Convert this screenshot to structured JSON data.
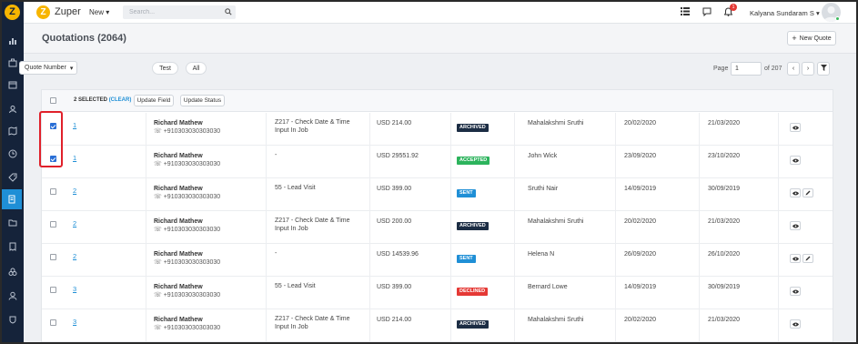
{
  "app": {
    "name": "Zuper",
    "new_menu": "New",
    "search_placeholder": "Search...",
    "user_name": "Kalyana Sundaram S",
    "notification_count": "1"
  },
  "page": {
    "title": "Quotations (2064)",
    "new_quote": "New Quote"
  },
  "filters": {
    "dropdown": "Quote Number",
    "pills": [
      "Test",
      "All"
    ]
  },
  "pagination": {
    "label": "Page",
    "current": "1",
    "total": "of 207"
  },
  "selection": {
    "count_text": "2 SELECTED",
    "clear_text": "(CLEAR)",
    "update_field": "Update Field",
    "update_status": "Update Status"
  },
  "colors": {
    "archived": "#1c2d44",
    "accepted": "#2cb35c",
    "sent": "#1f8fd6",
    "declined": "#e53935"
  },
  "rows": [
    {
      "checked": true,
      "number": "1",
      "customer": "Richard Mathew",
      "phone": "+910303030303030",
      "job": "Z217 - Check Date & Time Input In Job",
      "amount": "USD 214.00",
      "status": "ARCHIVED",
      "status_key": "archived",
      "assignee": "Mahalakshmi Sruthi",
      "date": "20/02/2020",
      "due": "21/03/2020",
      "editable": false
    },
    {
      "checked": true,
      "number": "1",
      "customer": "Richard Mathew",
      "phone": "+910303030303030",
      "job": "-",
      "amount": "USD 29551.92",
      "status": "ACCEPTED",
      "status_key": "accepted",
      "assignee": "John Wick",
      "date": "23/09/2020",
      "due": "23/10/2020",
      "editable": false
    },
    {
      "checked": false,
      "number": "2",
      "customer": "Richard Mathew",
      "phone": "+910303030303030",
      "job": "55 - Lead Visit",
      "amount": "USD 399.00",
      "status": "SENT",
      "status_key": "sent",
      "assignee": "Sruthi Nair",
      "date": "14/09/2019",
      "due": "30/09/2019",
      "editable": true
    },
    {
      "checked": false,
      "number": "2",
      "customer": "Richard Mathew",
      "phone": "+910303030303030",
      "job": "Z217 - Check Date & Time Input In Job",
      "amount": "USD 200.00",
      "status": "ARCHIVED",
      "status_key": "archived",
      "assignee": "Mahalakshmi Sruthi",
      "date": "20/02/2020",
      "due": "21/03/2020",
      "editable": false
    },
    {
      "checked": false,
      "number": "2",
      "customer": "Richard Mathew",
      "phone": "+910303030303030",
      "job": "-",
      "amount": "USD 14539.96",
      "status": "SENT",
      "status_key": "sent",
      "assignee": "Helena N",
      "date": "26/09/2020",
      "due": "26/10/2020",
      "editable": true
    },
    {
      "checked": false,
      "number": "3",
      "customer": "Richard Mathew",
      "phone": "+910303030303030",
      "job": "55 - Lead Visit",
      "amount": "USD 399.00",
      "status": "DECLINED",
      "status_key": "declined",
      "assignee": "Bernard Lowe",
      "date": "14/09/2019",
      "due": "30/09/2019",
      "editable": false
    },
    {
      "checked": false,
      "number": "3",
      "customer": "Richard Mathew",
      "phone": "+910303030303030",
      "job": "Z217 - Check Date & Time Input In Job",
      "amount": "USD 214.00",
      "status": "ARCHIVED",
      "status_key": "archived",
      "assignee": "Mahalakshmi Sruthi",
      "date": "20/02/2020",
      "due": "21/03/2020",
      "editable": false
    }
  ],
  "sidebar": {
    "icons": [
      "dashboard-icon",
      "jobs-icon",
      "calendar-icon",
      "customers-icon",
      "map-icon",
      "timesheet-icon",
      "tag-icon",
      "quotes-icon",
      "folder-icon",
      "invoice-icon",
      "integrations-icon",
      "users-icon",
      "settings-icon"
    ]
  }
}
